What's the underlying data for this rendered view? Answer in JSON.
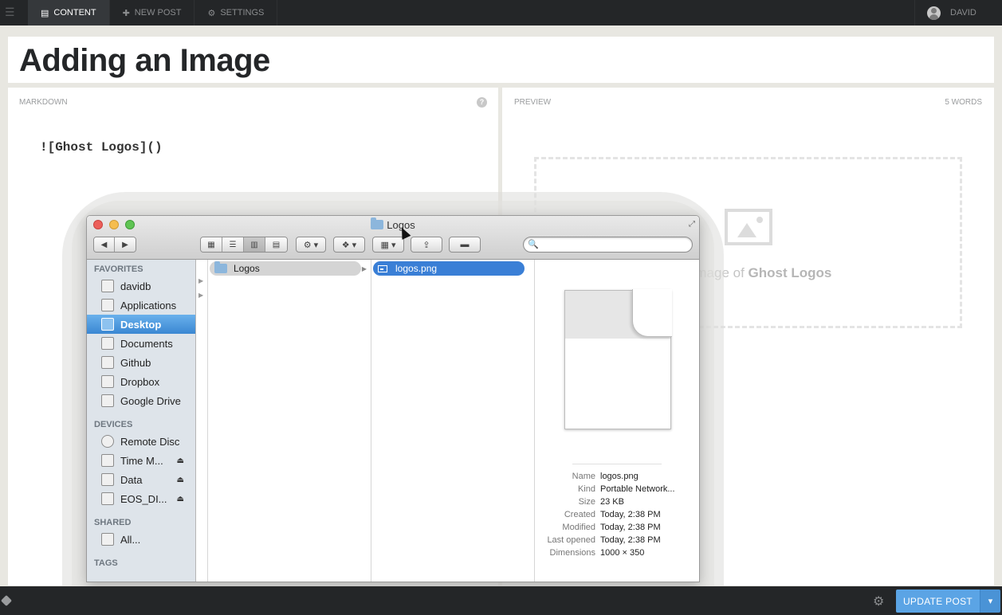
{
  "topnav": {
    "items": [
      {
        "label": "CONTENT",
        "icon": "content-icon"
      },
      {
        "label": "NEW POST",
        "icon": "plus-icon"
      },
      {
        "label": "SETTINGS",
        "icon": "gear-icon"
      }
    ],
    "user": "DAVID"
  },
  "post": {
    "title": "Adding an Image",
    "markdown_label": "MARKDOWN",
    "markdown_text": "![Ghost Logos]()",
    "preview_label": "PREVIEW",
    "word_count": "5 WORDS",
    "placeholder_prefix": "Add image of",
    "placeholder_name": "Ghost Logos"
  },
  "finder": {
    "title": "Logos",
    "sidebar": {
      "favorites_label": "FAVORITES",
      "favorites": [
        "davidb",
        "Applications",
        "Desktop",
        "Documents",
        "Github",
        "Dropbox",
        "Google Drive"
      ],
      "devices_label": "DEVICES",
      "devices": [
        "Remote Disc",
        "Time M...",
        "Data",
        "EOS_DI..."
      ],
      "shared_label": "SHARED",
      "shared": [
        "All..."
      ],
      "tags_label": "TAGS"
    },
    "column_folder": "Logos",
    "column_file": "logos.png",
    "info": {
      "name_k": "Name",
      "name_v": "logos.png",
      "kind_k": "Kind",
      "kind_v": "Portable Network...",
      "size_k": "Size",
      "size_v": "23 KB",
      "created_k": "Created",
      "created_v": "Today, 2:38 PM",
      "modified_k": "Modified",
      "modified_v": "Today, 2:38 PM",
      "opened_k": "Last opened",
      "opened_v": "Today, 2:38 PM",
      "dims_k": "Dimensions",
      "dims_v": "1000 × 350"
    }
  },
  "bottom": {
    "update_label": "UPDATE POST"
  },
  "colors": {
    "topbar": "#242628",
    "accent": "#5ba4e5",
    "finder_selection": "#3a7fd6"
  }
}
